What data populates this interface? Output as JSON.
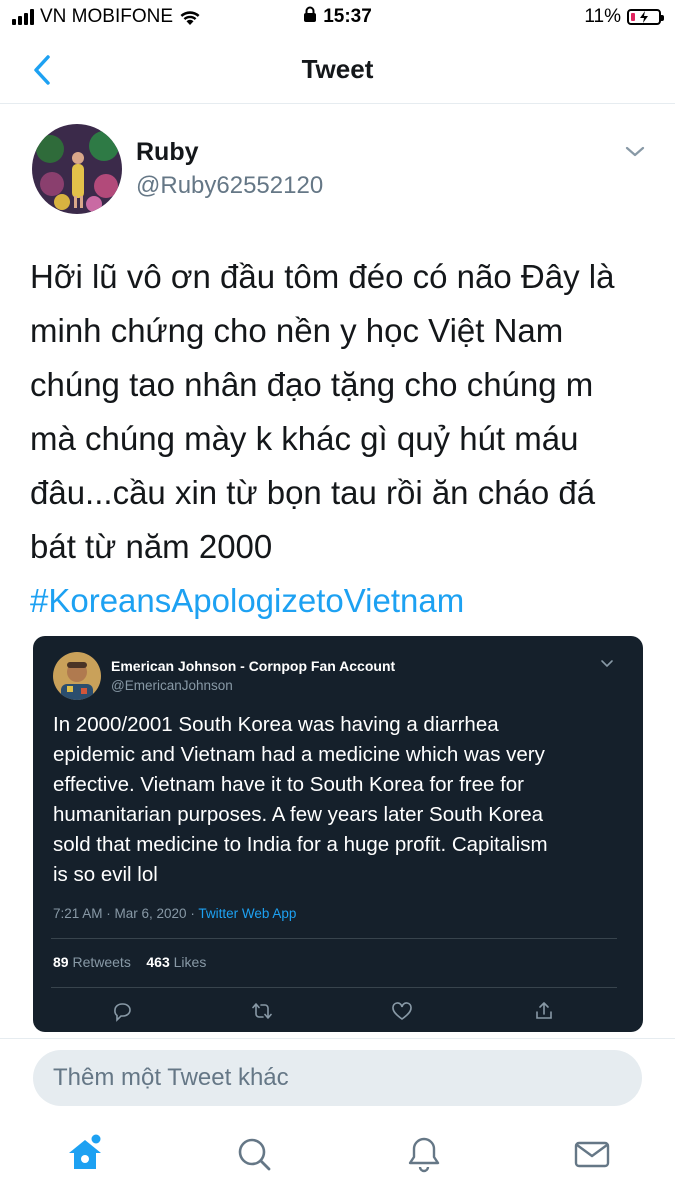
{
  "status_bar": {
    "carrier": "VN MOBIFONE",
    "time": "15:37",
    "battery": "11%"
  },
  "header": {
    "title": "Tweet"
  },
  "tweet": {
    "author_name": "Ruby",
    "author_handle": "@Ruby62552120",
    "text_lines": [
      "Hỡi lũ vô ơn đầu tôm đéo có não Đây là",
      "minh chứng cho nền y học Việt Nam",
      "chúng tao nhân đạo tặng cho chúng m",
      "mà chúng mày k khác gì quỷ hút máu",
      "đâu...cầu xin từ bọn tau rồi ăn cháo đá",
      "bát từ năm 2000"
    ],
    "hashtag": "#KoreansApologizetoVietnam"
  },
  "embedded": {
    "author_name": "Emerican Johnson - Cornpop Fan Account",
    "author_handle": "@EmericanJohnson",
    "text_lines": [
      "In 2000/2001 South Korea was having a diarrhea",
      "epidemic and Vietnam had a medicine which was very",
      "effective. Vietnam have it to South Korea for free for",
      "humanitarian purposes. A few years later South Korea",
      "sold that medicine to India for a huge profit. Capitalism",
      "is so evil lol"
    ],
    "timestamp": "7:21 AM · Mar 6, 2020 · ",
    "via": "Twitter Web App",
    "retweets_count": "89",
    "retweets_label": " Retweets",
    "likes_count": "463",
    "likes_label": " Likes"
  },
  "reply": {
    "placeholder": "Thêm một Tweet khác"
  },
  "tabs": [
    "home",
    "search",
    "notifications",
    "messages"
  ],
  "colors": {
    "accent": "#1da1f2",
    "card_bg": "#15202b",
    "secondary_text": "#657786"
  }
}
